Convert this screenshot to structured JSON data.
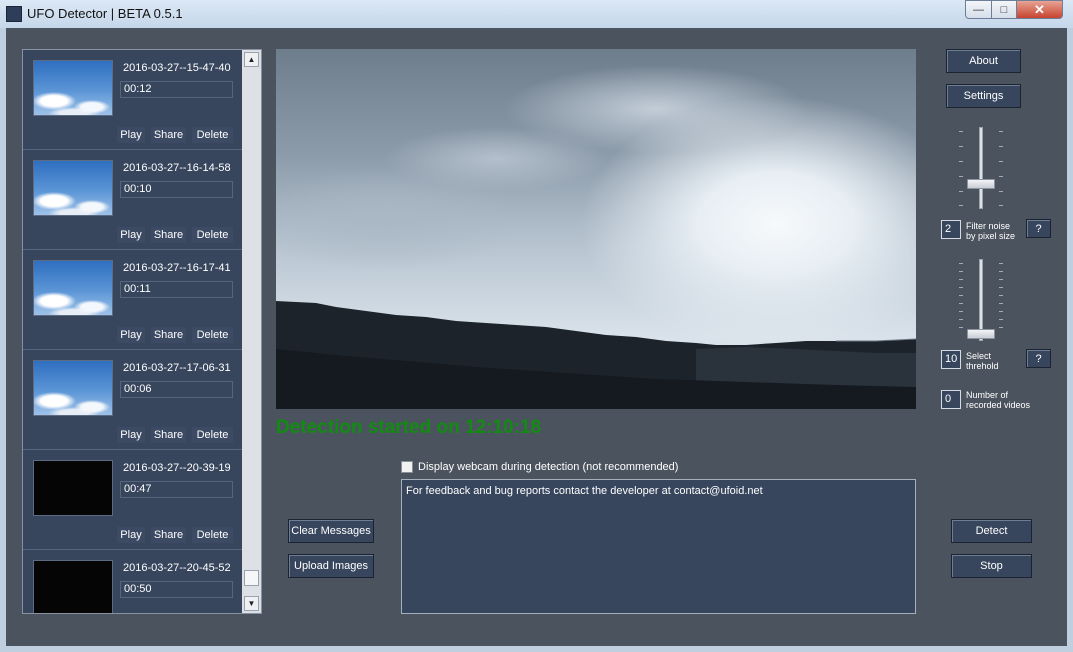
{
  "window": {
    "title": "UFO Detector | BETA 0.5.1"
  },
  "recordings": [
    {
      "name": "2016-03-27--15-47-40",
      "duration": "00:12",
      "thumb": "sky"
    },
    {
      "name": "2016-03-27--16-14-58",
      "duration": "00:10",
      "thumb": "sky"
    },
    {
      "name": "2016-03-27--16-17-41",
      "duration": "00:11",
      "thumb": "sky"
    },
    {
      "name": "2016-03-27--17-06-31",
      "duration": "00:06",
      "thumb": "sky"
    },
    {
      "name": "2016-03-27--20-39-19",
      "duration": "00:47",
      "thumb": "black"
    },
    {
      "name": "2016-03-27--20-45-52",
      "duration": "00:50",
      "thumb": "black"
    }
  ],
  "item_buttons": {
    "play": "Play",
    "share": "Share",
    "delete": "Delete"
  },
  "status": {
    "text": "Detection started on 12:10:18",
    "color": "#118c11"
  },
  "webcam_checkbox": {
    "label": "Display webcam during detection (not recommended)",
    "checked": false
  },
  "messages": {
    "text": "For feedback and bug reports contact the developer at contact@ufoid.net"
  },
  "buttons": {
    "about": "About",
    "settings": "Settings",
    "clear_messages": "Clear Messages",
    "upload_images": "Upload Images",
    "detect": "Detect",
    "stop": "Stop",
    "help": "?"
  },
  "controls": {
    "filter_noise": {
      "value": "2",
      "label_line1": "Filter noise",
      "label_line2": "by pixel size",
      "slider_level": 0.25
    },
    "threshold": {
      "value": "10",
      "label_line1": "Select",
      "label_line2": "threhold",
      "slider_level": 0.0
    },
    "recorded": {
      "value": "0",
      "label_line1": "Number of",
      "label_line2": "recorded videos"
    }
  },
  "colors": {
    "panel": "#37455d",
    "background": "#4b545e",
    "accent_text": "#ffffff"
  }
}
